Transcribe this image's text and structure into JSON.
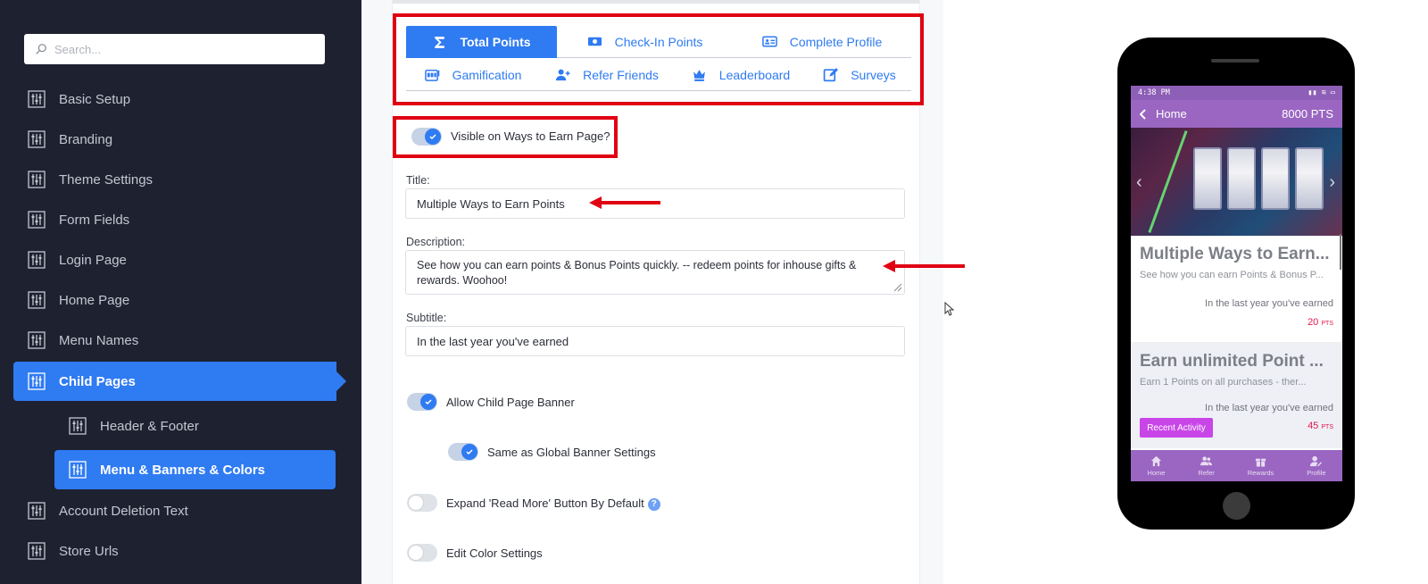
{
  "sidebar": {
    "search_placeholder": "Search...",
    "items": [
      {
        "label": "Basic Setup"
      },
      {
        "label": "Branding"
      },
      {
        "label": "Theme Settings"
      },
      {
        "label": "Form Fields"
      },
      {
        "label": "Login Page"
      },
      {
        "label": "Home Page"
      },
      {
        "label": "Menu Names"
      },
      {
        "label": "Child Pages"
      },
      {
        "label": "Header & Footer"
      },
      {
        "label": "Menu & Banners & Colors"
      },
      {
        "label": "Account Deletion Text"
      },
      {
        "label": "Store Urls"
      }
    ]
  },
  "tabs": [
    {
      "label": "Total Points",
      "icon": "sigma-icon"
    },
    {
      "label": "Check-In Points",
      "icon": "cash-icon"
    },
    {
      "label": "Complete Profile",
      "icon": "id-card-icon"
    },
    {
      "label": "Gamification",
      "icon": "slot-machine-icon"
    },
    {
      "label": "Refer Friends",
      "icon": "user-plus-icon"
    },
    {
      "label": "Leaderboard",
      "icon": "crown-icon"
    },
    {
      "label": "Surveys",
      "icon": "edit-icon"
    }
  ],
  "form": {
    "visible_label": "Visible on Ways to Earn Page?",
    "title_label": "Title:",
    "title_value": "Multiple Ways to Earn Points",
    "description_label": "Description:",
    "description_value": "See how you can earn points & Bonus Points quickly. -- redeem points for inhouse gifts & rewards. Woohoo!",
    "subtitle_label": "Subtitle:",
    "subtitle_value": "In the last year you've earned",
    "allow_banner_label": "Allow Child Page Banner",
    "same_global_label": "Same as Global Banner Settings",
    "expand_read_more_label": "Expand 'Read More' Button By Default",
    "help_glyph": "?",
    "edit_color_label": "Edit Color Settings"
  },
  "colors": {
    "accent": "#2f7bf2",
    "highlight": "#e00012",
    "sidebar_bg": "#1e2130",
    "phone_purple": "#9a66c2"
  },
  "phone": {
    "time": "4:38 PM",
    "header_title": "Home",
    "header_points": "8000 PTS",
    "cards": [
      {
        "title": "Multiple Ways to Earn...",
        "desc": "See how you can earn Points & Bonus P...",
        "subtitle": "In the last year you've earned",
        "points": "20",
        "unit": "PTS"
      },
      {
        "title": "Earn unlimited Point ...",
        "desc": "Earn 1 Points on all purchases - ther...",
        "subtitle": "In the last year you've earned",
        "points": "45",
        "unit": "PTS",
        "button": "Recent Activity"
      }
    ],
    "nav": [
      "Home",
      "Refer",
      "Rewards",
      "Profile"
    ]
  }
}
